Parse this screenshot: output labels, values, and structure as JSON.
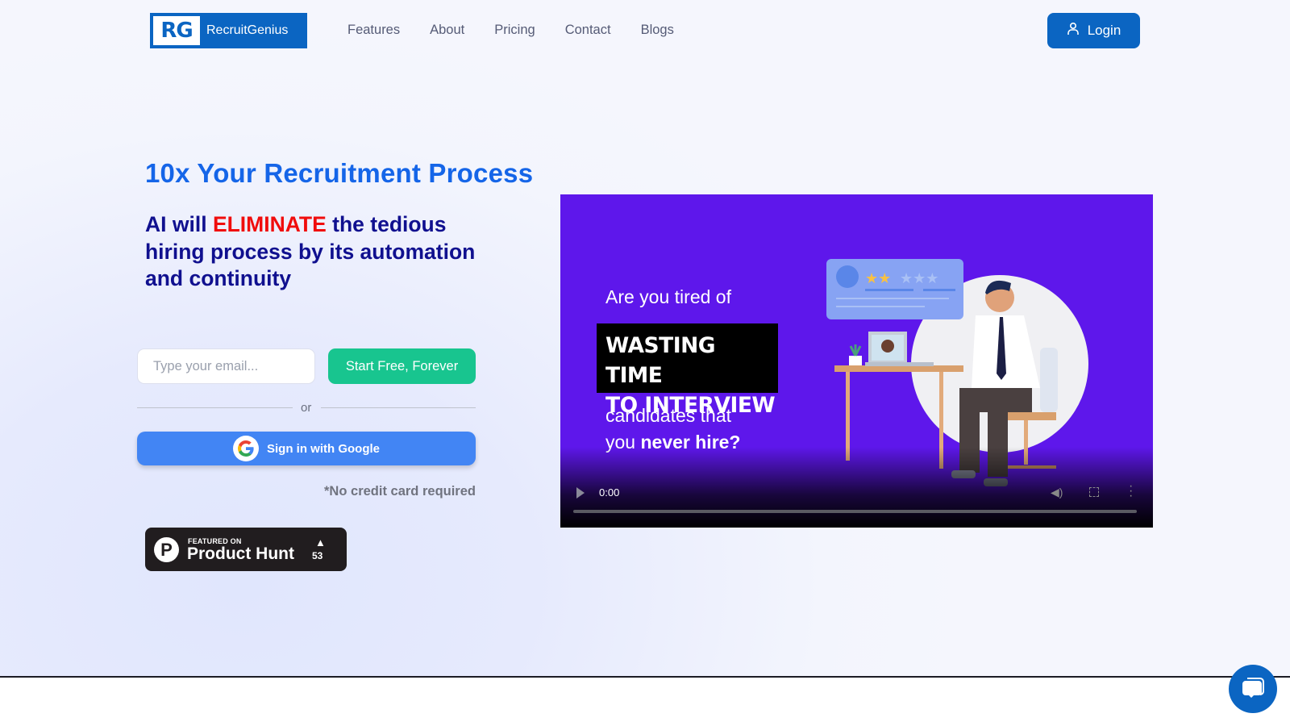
{
  "brand": {
    "logo_mark": "RG",
    "name": "RecruitGenius",
    "primary_color": "#0b65c2"
  },
  "nav": {
    "items": [
      {
        "label": "Features"
      },
      {
        "label": "About"
      },
      {
        "label": "Pricing"
      },
      {
        "label": "Contact"
      },
      {
        "label": "Blogs"
      }
    ],
    "login_label": "Login",
    "login_icon": "user-icon"
  },
  "hero": {
    "title": "10x Your Recruitment Process",
    "subtitle_pre": "AI will ",
    "subtitle_highlight": "ELIMINATE",
    "subtitle_post": " the tedious hiring process by its automation and continuity",
    "email_placeholder": "Type your email...",
    "email_value": "",
    "start_button": "Start Free, Forever",
    "or_text": "or",
    "google_button": "Sign in with Google",
    "no_credit_card": "*No credit card required",
    "colors": {
      "title": "#1565e8",
      "subtitle": "#10108f",
      "highlight": "#f00c0c",
      "start_button": "#18c58f",
      "google_button": "#4285f4"
    }
  },
  "product_hunt": {
    "logo_letter": "P",
    "featured": "FEATURED ON",
    "name": "Product Hunt",
    "upvote_icon": "▲",
    "count": "53"
  },
  "video": {
    "line1": "Are you tired of",
    "box_line1": "WASTING TIME",
    "box_line2": "TO INTERVIEW",
    "line3": "candidates that",
    "line4_pre": "you ",
    "line4_bold": "never hire?",
    "current_time": "0:00",
    "progress": 0,
    "background_color": "#5e17eb"
  },
  "chat": {
    "icon": "chat-bubble-icon"
  }
}
